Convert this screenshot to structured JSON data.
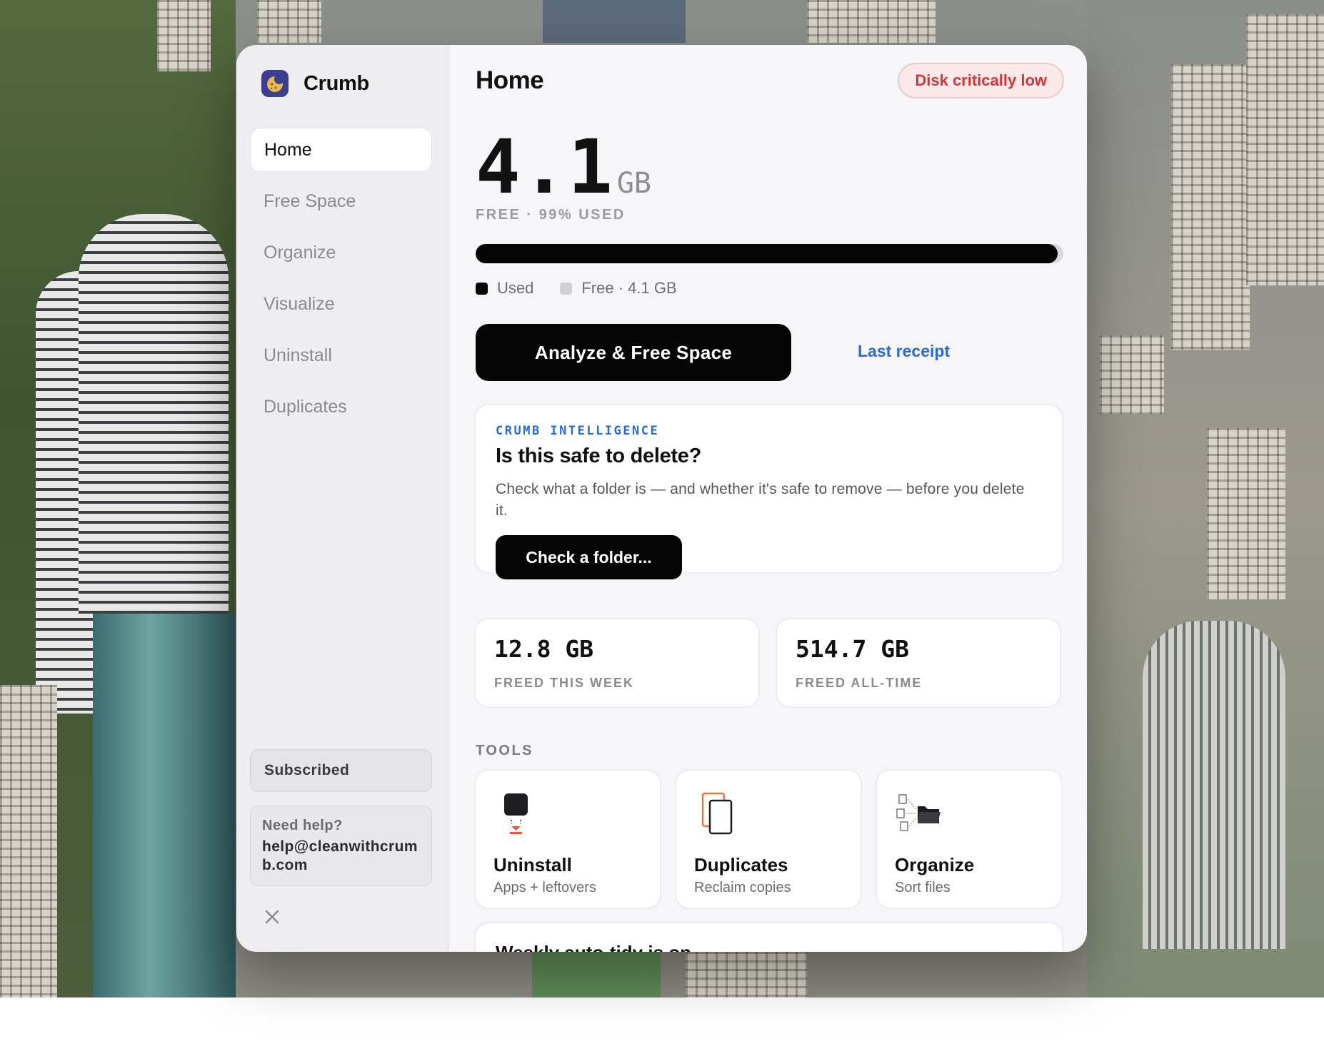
{
  "app": {
    "name": "Crumb"
  },
  "sidebar": {
    "items": [
      {
        "label": "Home",
        "active": true
      },
      {
        "label": "Free Space",
        "active": false
      },
      {
        "label": "Organize",
        "active": false
      },
      {
        "label": "Visualize",
        "active": false
      },
      {
        "label": "Uninstall",
        "active": false
      },
      {
        "label": "Duplicates",
        "active": false
      }
    ],
    "subscription": "Subscribed",
    "help": {
      "title": "Need help?",
      "email": "help@cleanwithcrumb.com"
    }
  },
  "header": {
    "title": "Home",
    "status_pill": "Disk critically low"
  },
  "disk": {
    "free_value": "4.1",
    "free_unit": "GB",
    "summary": "FREE · 99% USED",
    "used_fraction": 0.99,
    "legend_used": "Used",
    "legend_free": "Free · 4.1 GB"
  },
  "actions": {
    "primary": "Analyze & Free Space",
    "secondary": "Last receipt"
  },
  "intelligence": {
    "kicker": "CRUMB INTELLIGENCE",
    "title": "Is this safe to delete?",
    "body": "Check what a folder is — and whether it's safe to remove — before you delete it.",
    "button": "Check a folder..."
  },
  "stats": [
    {
      "value": "12.8 GB",
      "label": "FREED THIS WEEK"
    },
    {
      "value": "514.7 GB",
      "label": "FREED ALL-TIME"
    }
  ],
  "tools": {
    "label": "TOOLS",
    "items": [
      {
        "name": "Uninstall",
        "desc": "Apps + leftovers",
        "icon": "uninstall-icon"
      },
      {
        "name": "Duplicates",
        "desc": "Reclaim copies",
        "icon": "duplicates-icon"
      },
      {
        "name": "Organize",
        "desc": "Sort files",
        "icon": "organize-icon"
      }
    ]
  },
  "auto_tidy": {
    "title": "Weekly auto-tidy is on"
  },
  "colors": {
    "accent_blue": "#2a6ad6",
    "alert_red": "#d0373a",
    "primary_black": "#050505",
    "sidebar_bg": "#eeeef0",
    "main_bg": "#f6f6f8"
  }
}
